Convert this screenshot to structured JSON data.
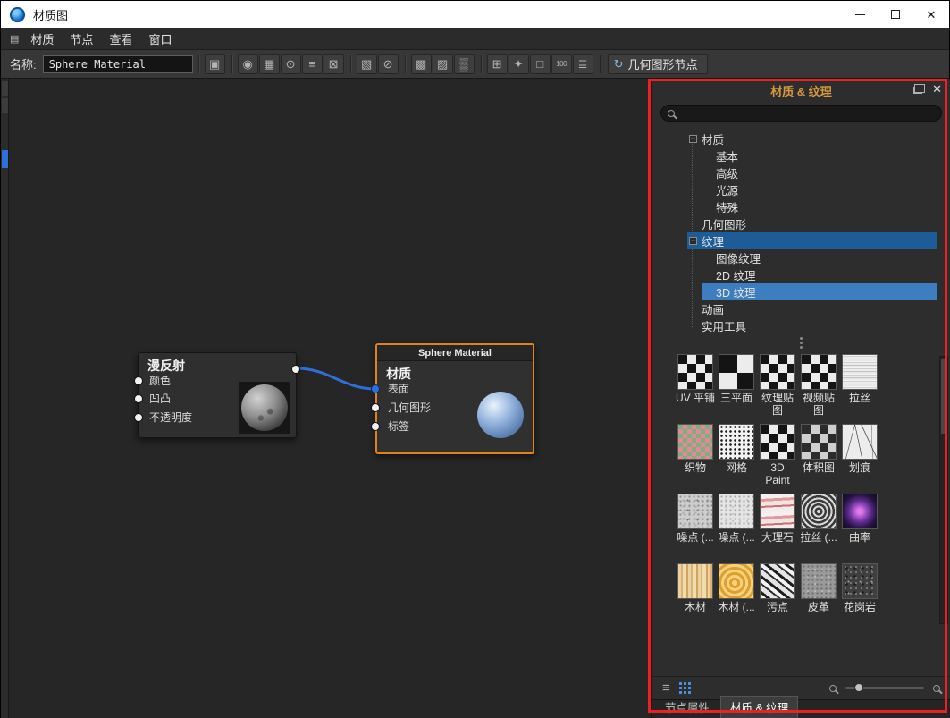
{
  "window": {
    "title": "材质图"
  },
  "icons": {
    "close": "✕",
    "list_view": "≡",
    "recycle": "↻",
    "menu_grid": "▤",
    "minus": "−",
    "plus": "+"
  },
  "menubar": {
    "items": [
      "材质",
      "节点",
      "查看",
      "窗口"
    ]
  },
  "toolbar": {
    "name_label": "名称:",
    "name_value": "Sphere Material",
    "geometry_button_label": "几何图形节点",
    "icons": [
      {
        "name": "save",
        "glyph": "▣"
      },
      {
        "name": "material-sphere",
        "glyph": "◉"
      },
      {
        "name": "checker-view",
        "glyph": "▦"
      },
      {
        "name": "preview",
        "glyph": "⊙"
      },
      {
        "name": "align",
        "glyph": "≡"
      },
      {
        "name": "lock",
        "glyph": "⊠"
      },
      {
        "name": "duplicate",
        "glyph": "▧"
      },
      {
        "name": "delete",
        "glyph": "⊘"
      },
      {
        "name": "texture-a",
        "glyph": "▩"
      },
      {
        "name": "texture-b",
        "glyph": "▨"
      },
      {
        "name": "texture-c",
        "glyph": "▒"
      },
      {
        "name": "add-node",
        "glyph": "⊞"
      },
      {
        "name": "effects",
        "glyph": "✦"
      },
      {
        "name": "frame",
        "glyph": "□"
      },
      {
        "name": "zoom-100",
        "glyph": "100"
      },
      {
        "name": "hierarchy",
        "glyph": "≣"
      }
    ]
  },
  "graph": {
    "diffuse": {
      "title": "漫反射",
      "ports": [
        "颜色",
        "凹凸",
        "不透明度"
      ]
    },
    "material": {
      "header": "Sphere Material",
      "title": "材质",
      "ports": [
        "表面",
        "几何图形",
        "标签"
      ]
    }
  },
  "panel": {
    "title": "材质 & 纹理",
    "search_placeholder": "",
    "tree": [
      {
        "label": "材质",
        "expander": "−"
      },
      {
        "label": "基本",
        "expander": ""
      },
      {
        "label": "高级",
        "expander": ""
      },
      {
        "label": "光源",
        "expander": ""
      },
      {
        "label": "特殊",
        "expander": ""
      },
      {
        "label": "几何图形",
        "expander": ""
      },
      {
        "label": "纹理",
        "expander": "−"
      },
      {
        "label": "图像纹理",
        "expander": ""
      },
      {
        "label": "2D 纹理",
        "expander": ""
      },
      {
        "label": "3D 纹理",
        "expander": ""
      },
      {
        "label": "动画",
        "expander": ""
      },
      {
        "label": "实用工具",
        "expander": ""
      }
    ],
    "thumbnails": [
      {
        "label": "UV 平铺",
        "pattern": "checker-fine"
      },
      {
        "label": "三平面",
        "pattern": "checker-big"
      },
      {
        "label": "纹理贴图",
        "pattern": "checker-fine"
      },
      {
        "label": "视频贴图",
        "pattern": "checker-fine"
      },
      {
        "label": "拉丝",
        "pattern": "brushed"
      },
      {
        "label": "织物",
        "pattern": "fabric"
      },
      {
        "label": "网格",
        "pattern": "dots-grid"
      },
      {
        "label": "3D Paint",
        "pattern": "checker-fine"
      },
      {
        "label": "体积图",
        "pattern": "checker-gray"
      },
      {
        "label": "划痕",
        "pattern": "scratches"
      },
      {
        "label": "噪点 (...",
        "pattern": "noise-mid"
      },
      {
        "label": "噪点 (...",
        "pattern": "noise-light"
      },
      {
        "label": "大理石",
        "pattern": "marble-red"
      },
      {
        "label": "拉丝 (...",
        "pattern": "rings-gray"
      },
      {
        "label": "曲率",
        "pattern": "swirl-purple"
      },
      {
        "label": "木材",
        "pattern": "wood-v"
      },
      {
        "label": "木材 (...",
        "pattern": "wood-rings"
      },
      {
        "label": "污点",
        "pattern": "ink-marble"
      },
      {
        "label": "皮革",
        "pattern": "leather-gray"
      },
      {
        "label": "花岗岩",
        "pattern": "granite-dark"
      }
    ],
    "bottom_tabs": [
      "节点属性",
      "材质 & 纹理"
    ]
  }
}
